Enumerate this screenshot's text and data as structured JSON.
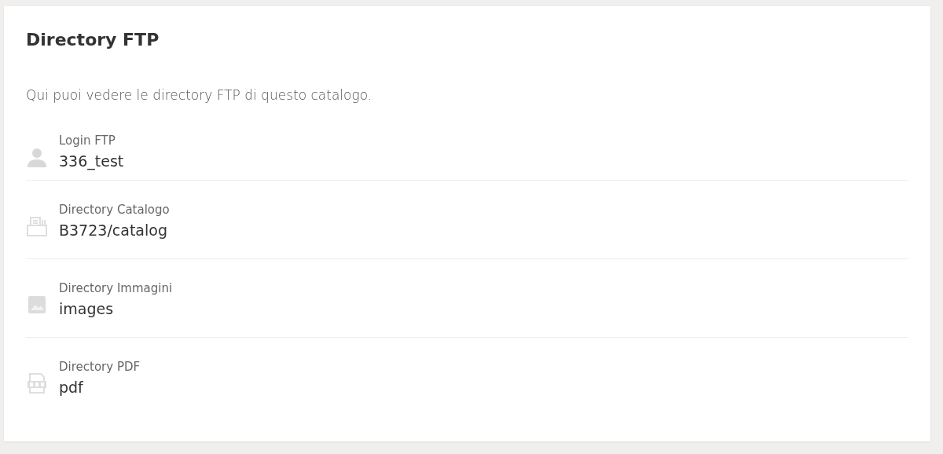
{
  "title": "Directory FTP",
  "description": "Qui puoi vedere le directory FTP di questo catalogo.",
  "items": [
    {
      "kind": "user",
      "label": "Login FTP",
      "value": "336_test"
    },
    {
      "kind": "catalog",
      "label": "Directory Catalogo",
      "value": "B3723/catalog"
    },
    {
      "kind": "image",
      "label": "Directory Immagini",
      "value": "images"
    },
    {
      "kind": "pdf",
      "label": "Directory PDF",
      "value": "pdf"
    }
  ]
}
